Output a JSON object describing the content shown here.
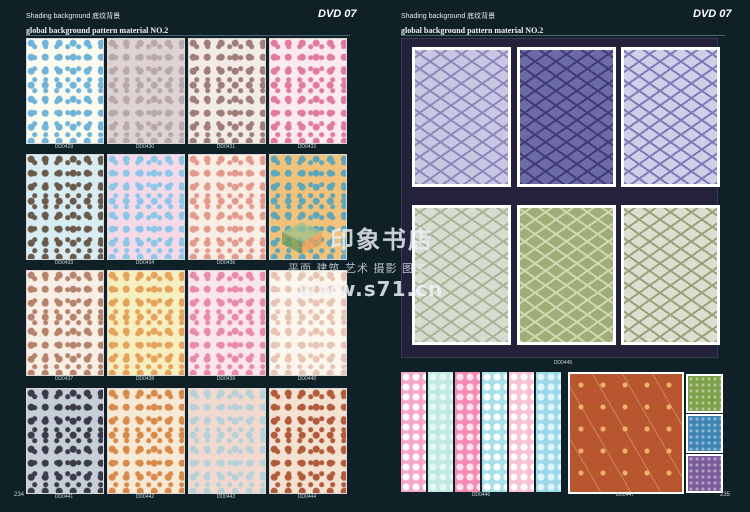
{
  "left_page": {
    "header": "Shading background 底纹背景",
    "dvd_badge": "DVD 07",
    "subtitle": "global background pattern material NO.2",
    "page_number": "234",
    "tiles": [
      {
        "code": "DD0429",
        "bg": "#fbfbf0",
        "fg": "#6fb3d9"
      },
      {
        "code": "DD0430",
        "bg": "#ddd3d3",
        "fg": "#b9a8a8"
      },
      {
        "code": "DD0431",
        "bg": "#f3ebe6",
        "fg": "#a07d78"
      },
      {
        "code": "DD0432",
        "bg": "#fbeaf0",
        "fg": "#e07aa0"
      },
      {
        "code": "DD0433",
        "bg": "#d8ecf3",
        "fg": "#6a5a4a"
      },
      {
        "code": "DD0434",
        "bg": "#f6d9e6",
        "fg": "#8cc6e8"
      },
      {
        "code": "DD0436",
        "bg": "#f8eee6",
        "fg": "#e39a8c"
      },
      {
        "code": "",
        "bg": "#f3c27a",
        "fg": "#5fa7b8"
      },
      {
        "code": "DD0437",
        "bg": "#f7eee6",
        "fg": "#b7826a"
      },
      {
        "code": "DD0438",
        "bg": "#f6efc0",
        "fg": "#e6a15a"
      },
      {
        "code": "DD0439",
        "bg": "#fbe6ef",
        "fg": "#e88aa8"
      },
      {
        "code": "DD0440",
        "bg": "#fcf7ee",
        "fg": "#e8c4b4"
      },
      {
        "code": "DD0441",
        "bg": "#c6ced6",
        "fg": "#3a3a4a"
      },
      {
        "code": "DD0442",
        "bg": "#f6ead6",
        "fg": "#d98a4a"
      },
      {
        "code": "DD0443",
        "bg": "#f1d9cf",
        "fg": "#b7d1d9"
      },
      {
        "code": "DD0444",
        "bg": "#f3e2d2",
        "fg": "#b25a3a"
      }
    ]
  },
  "right_page": {
    "header": "Shading background 底纹背景",
    "dvd_badge": "DVD 07",
    "subtitle": "global background pattern material NO.2",
    "page_number": "235",
    "big_caption": "DD0445",
    "big_panels": [
      {
        "bg": "#c9c7e3",
        "fg": "#8c89b6"
      },
      {
        "bg": "#6d6aa8",
        "fg": "#3e3b76"
      },
      {
        "bg": "#d0cfe8",
        "fg": "#7e79b8"
      },
      {
        "bg": "#d6dcd0",
        "fg": "#a9b398"
      },
      {
        "bg": "#9fae78",
        "fg": "#d0d9b2"
      },
      {
        "bg": "#dcdfcf",
        "fg": "#98a27a"
      }
    ],
    "strips_caption": "DD0446",
    "strips": [
      {
        "bg": "#f7a6c6",
        "fg": "#ffffff"
      },
      {
        "bg": "#bfe9e1",
        "fg": "#e5f7f3"
      },
      {
        "bg": "#f58bb2",
        "fg": "#ffe4ee"
      },
      {
        "bg": "#a6e0ea",
        "fg": "#ffffff"
      },
      {
        "bg": "#f9c0d6",
        "fg": "#ffffff"
      },
      {
        "bg": "#9ad8ea",
        "fg": "#e0f5fb"
      }
    ],
    "retro_caption": "DD0447",
    "retro": {
      "bg": "#b8562f",
      "fg": "#efb36a"
    },
    "swatches": [
      {
        "bg": "#7fa04a"
      },
      {
        "bg": "#3f86b3"
      },
      {
        "bg": "#7a5c9a"
      }
    ]
  },
  "watermark": {
    "title": "印象书店",
    "subtitle": "平面 建筑 艺术 摄影 图库",
    "url": "www.s71.cn"
  }
}
